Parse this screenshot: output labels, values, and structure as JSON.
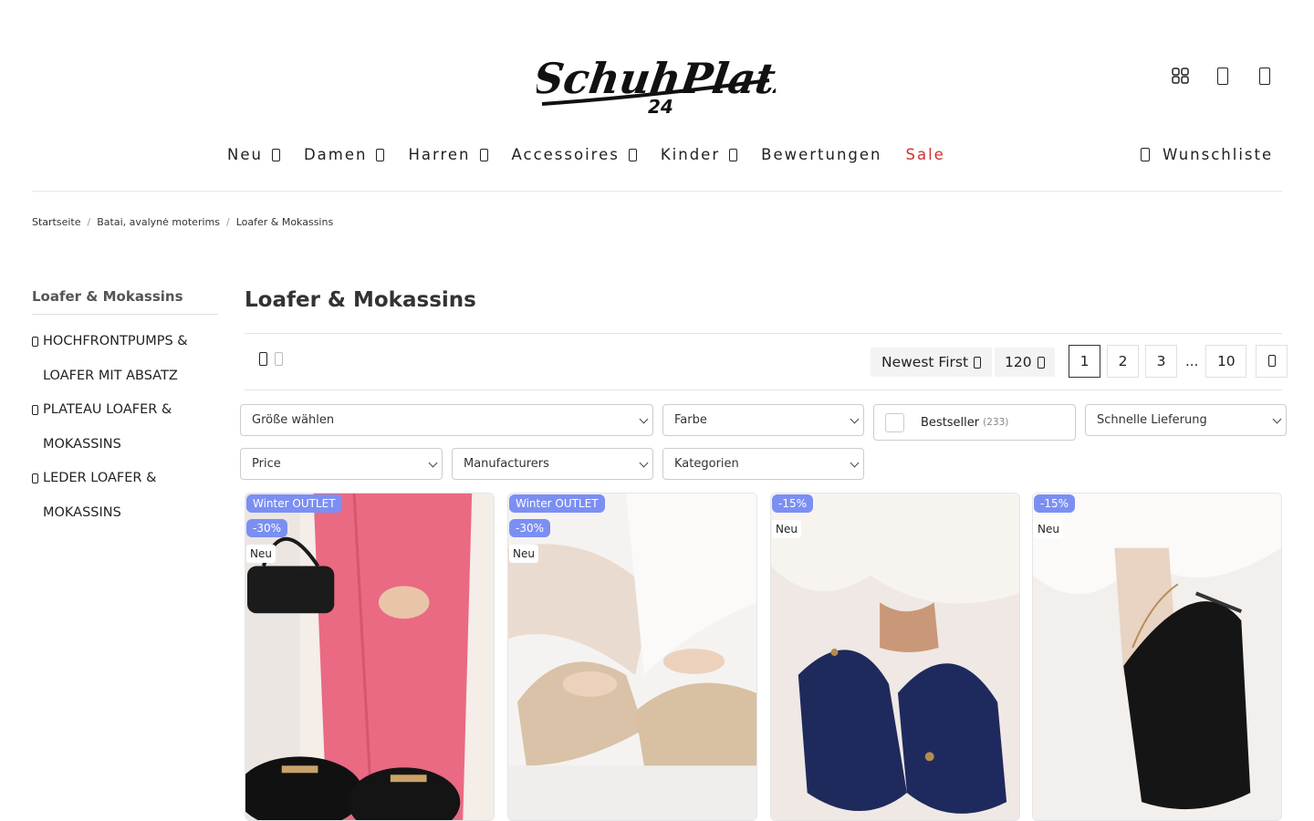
{
  "brand": {
    "name": "SchuhPlatz",
    "sub": "24"
  },
  "nav": {
    "items": [
      {
        "label": "Neu",
        "has_dropdown": true
      },
      {
        "label": "Damen",
        "has_dropdown": true
      },
      {
        "label": "Harren",
        "has_dropdown": true
      },
      {
        "label": "Accessoires",
        "has_dropdown": true
      },
      {
        "label": "Kinder",
        "has_dropdown": true
      },
      {
        "label": "Bewertungen",
        "has_dropdown": false
      },
      {
        "label": "Sale",
        "has_dropdown": false,
        "color": "#d32f2f"
      }
    ],
    "wishlist_label": "Wunschliste"
  },
  "header_icons": [
    "grid-icon",
    "user-icon",
    "cart-icon"
  ],
  "breadcrumb": [
    "Startseite",
    "Batai, avalynė moterims",
    "Loafer & Mokassins"
  ],
  "sidebar": {
    "title": "Loafer & Mokassins",
    "items": [
      "HOCHFRONTPUMPS & LOAFER MIT ABSATZ",
      "PLATEAU LOAFER & MOKASSINS",
      "LEDER LOAFER & MOKASSINS"
    ]
  },
  "content": {
    "title": "Loafer & Mokassins",
    "sort_label": "Newest First",
    "per_page": "120",
    "pages": [
      "1",
      "2",
      "3",
      "...",
      "10"
    ],
    "current_page": "1"
  },
  "filters": {
    "size": "Größe wählen",
    "color": "Farbe",
    "bestseller_label": "Bestseller",
    "bestseller_count": "(233)",
    "delivery": "Schnelle Lieferung",
    "price": "Price",
    "manufacturers": "Manufacturers",
    "categories": "Kategorien"
  },
  "products": [
    {
      "badges": [
        "Winter OUTLET",
        "-30%"
      ],
      "new_label": "Neu"
    },
    {
      "badges": [
        "Winter OUTLET",
        "-30%"
      ],
      "new_label": "Neu"
    },
    {
      "badges": [
        "-15%"
      ],
      "new_label": "Neu"
    },
    {
      "badges": [
        "-15%"
      ],
      "new_label": "Neu"
    }
  ],
  "colors": {
    "accent_badge": "#7b8ff3",
    "sale": "#d32f2f",
    "text": "#222222"
  }
}
